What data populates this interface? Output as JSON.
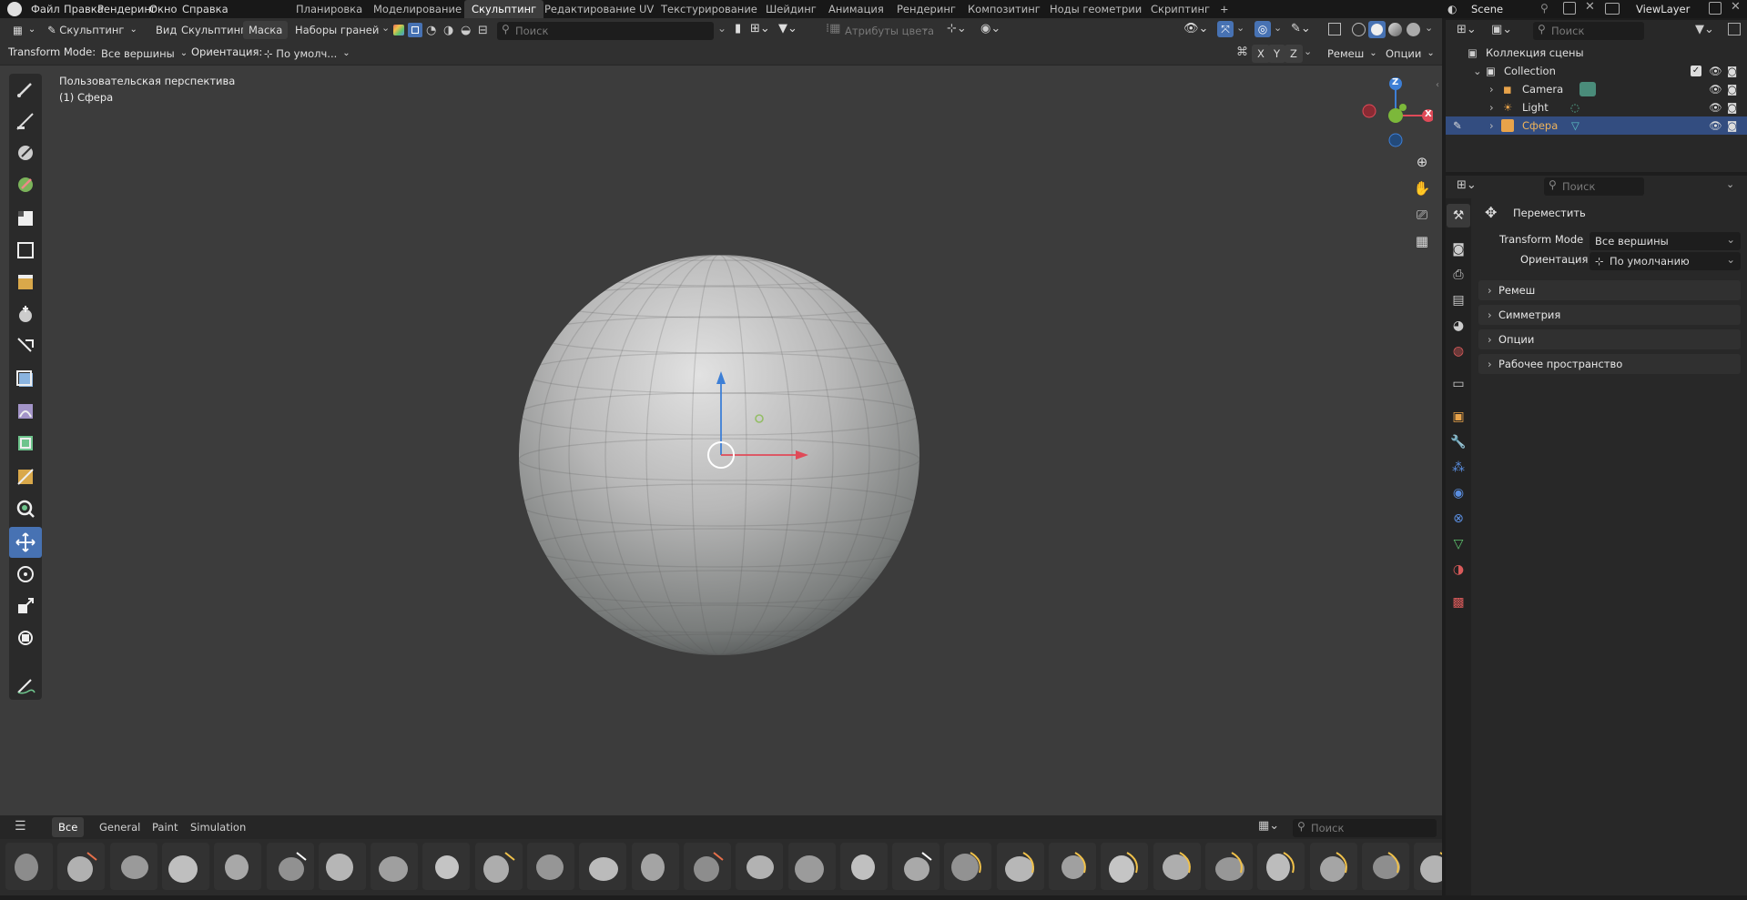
{
  "menu": {
    "items": [
      "Файл",
      "Правка",
      "Рендеринг",
      "Окно",
      "Справка"
    ]
  },
  "workspaces": {
    "tabs": [
      "Планировка",
      "Моделирование",
      "Скульптинг",
      "Редактирование UV",
      "Текстурирование",
      "Шейдинг",
      "Анимация",
      "Рендеринг",
      "Композитинг",
      "Ноды геометрии",
      "Скриптинг"
    ],
    "active": "Скульптинг",
    "add": "+"
  },
  "scene": {
    "name": "Scene",
    "view_layer": "ViewLayer"
  },
  "header": {
    "mode": "Скульптинг",
    "view": "Вид",
    "sculpt": "Скульптинг",
    "mask": "Маска",
    "face_sets": "Наборы граней",
    "search_placeholder": "Поиск",
    "color_attr": "Атрибуты цвета"
  },
  "tool_header": {
    "transform_mode_label": "Transform Mode:",
    "transform_mode_value": "Все вершины",
    "orientation_label": "Ориентация:",
    "orientation_value": "По умолч...",
    "x": "X",
    "y": "Y",
    "z": "Z",
    "remesh": "Ремеш",
    "options": "Опции"
  },
  "viewport": {
    "perspective": "Пользовательская перспектива",
    "object": "(1) Сфера"
  },
  "gizmo": {
    "z": "Z",
    "x": "X"
  },
  "shelf": {
    "tabs": [
      "Все",
      "General",
      "Paint",
      "Simulation"
    ],
    "active": "Все",
    "search_placeholder": "Поиск"
  },
  "outliner": {
    "search_placeholder": "Поиск",
    "root": "Коллекция сцены",
    "collection": "Collection",
    "items": [
      "Camera",
      "Light",
      "Сфера"
    ]
  },
  "properties": {
    "search_placeholder": "Поиск",
    "tool_name": "Переместить",
    "transform_mode_label": "Transform Mode",
    "transform_mode_value": "Все вершины",
    "orientation_label": "Ориентация",
    "orientation_value": "По умолчанию",
    "panels": [
      "Ремеш",
      "Симметрия",
      "Опции",
      "Рабочее пространство"
    ]
  },
  "colors": {
    "accent": "#4772b3",
    "selected_row": "#334d80",
    "object_orange": "#e8a34a",
    "x_axis": "#e04a58",
    "y_axis": "#7cb83a",
    "z_axis": "#3d7fd6"
  }
}
